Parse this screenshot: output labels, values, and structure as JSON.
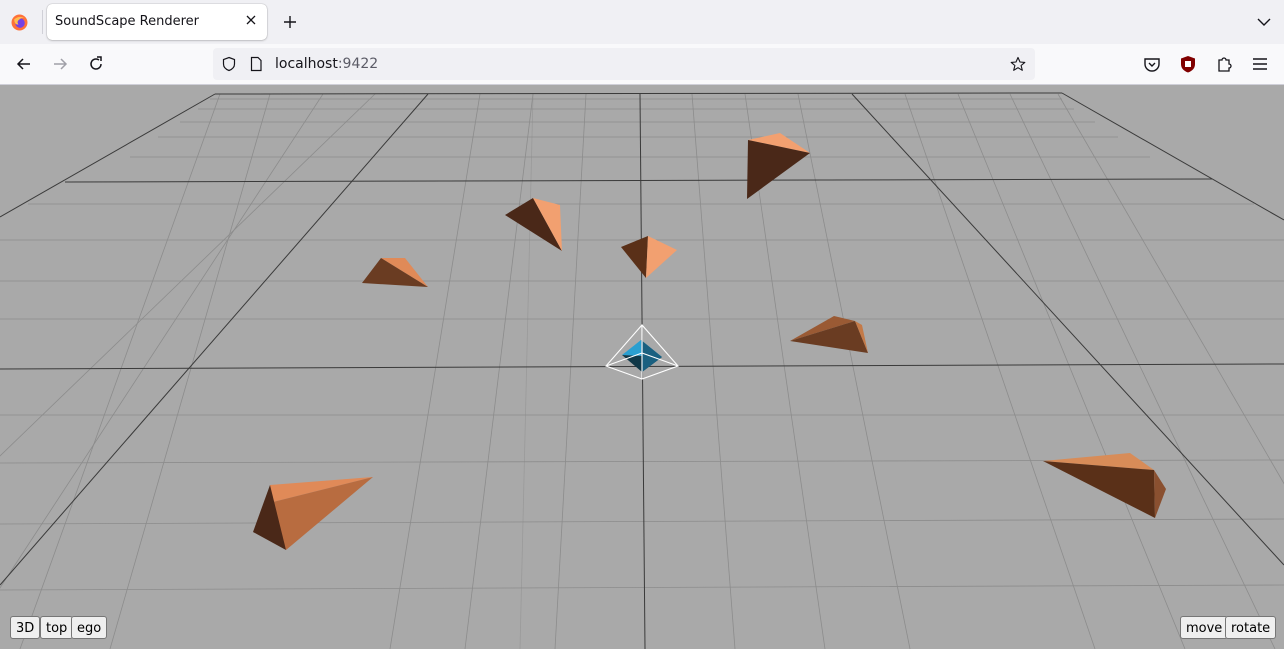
{
  "browser": {
    "tab_title": "SoundScape Renderer",
    "url_host": "localhost",
    "url_port": ":9422"
  },
  "view_buttons": [
    "3D",
    "top",
    "ego"
  ],
  "mode_buttons": [
    "move",
    "rotate"
  ],
  "colors": {
    "floor": "#a9a9a9",
    "grid_minor": "#8a8a8a",
    "grid_major": "#3a3a3a",
    "source_light": "#f2a070",
    "source_mid": "#b06a42",
    "source_dark": "#4a2818",
    "listener": "#1e90c0"
  },
  "icons": [
    "firefox-logo-icon",
    "close-icon",
    "plus-icon",
    "chevron-down-icon",
    "back-arrow-icon",
    "forward-arrow-icon",
    "reload-icon",
    "shield-icon",
    "page-icon",
    "star-icon",
    "pocket-icon",
    "ublock-icon",
    "extensions-icon",
    "menu-icon"
  ]
}
